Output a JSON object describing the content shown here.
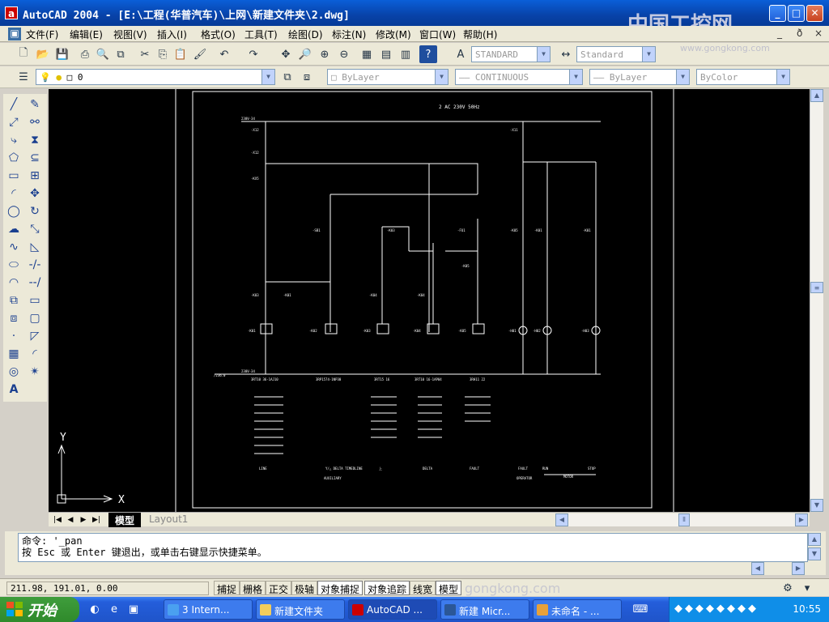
{
  "window": {
    "title": "AutoCAD 2004 - [E:\\工程(华普汽车)\\上网\\新建文件夹\\2.dwg]",
    "app_icon": "a"
  },
  "watermark": {
    "text": "中国工控网",
    "url": "www.gongkong.com",
    "status_url": "gongkong.com"
  },
  "menu": [
    "文件(F)",
    "编辑(E)",
    "视图(V)",
    "插入(I)",
    "格式(O)",
    "工具(T)",
    "绘图(D)",
    "标注(N)",
    "修改(M)",
    "窗口(W)",
    "帮助(H)"
  ],
  "toolbar": {
    "text_style": "STANDARD",
    "dim_style": "Standard",
    "layer": "0",
    "color": "ByLayer",
    "linetype": "CONTINUOUS",
    "lineweight": "ByLayer",
    "plotstyle": "ByColor"
  },
  "drawing": {
    "header": "2 AC 230V 50Hz",
    "bus_top_label": "230V-34",
    "bus_bottom_label": "230V-34",
    "ref_bottom_left": "/236.0",
    "col_labels_top": [
      "-X12",
      "-X12",
      "-X11"
    ],
    "relay_labels": [
      "-KX5",
      "-SB1",
      "-K03",
      "-FU1",
      "-K05",
      "-K01",
      "-K01",
      "-K03",
      "-K01",
      "-K04",
      "-K04",
      "-K05"
    ],
    "coil_labels": [
      "-K01",
      "-K02",
      "-K03",
      "-K04",
      "-K05",
      "-H01",
      "-H02",
      "-H03"
    ],
    "parts": [
      "3RT10 36-1AJ10",
      "3RP1574-1NP30",
      "3RT15 16",
      "3RT10 16-1AP04",
      "3RH11 22"
    ],
    "functions": [
      "LINE",
      "Y/△ DELTA TIMEDLINE",
      "上",
      "DELTA",
      "FAULT",
      "FAULT",
      "RUN",
      "STOP"
    ],
    "footer_left": "AUXILIARY",
    "footer_mid": "OPERATOR",
    "footer_right": "MOTOR"
  },
  "ucs": {
    "x": "X",
    "y": "Y"
  },
  "tabs": [
    "模型",
    "Layout1"
  ],
  "command": {
    "line1": "命令: '_pan",
    "line2": "按 Esc 或 Enter 键退出，或单击右键显示快捷菜单。"
  },
  "status": {
    "coords": "211.98, 191.01, 0.00",
    "toggles": [
      "捕捉",
      "栅格",
      "正交",
      "极轴",
      "对象捕捉",
      "对象追踪",
      "线宽",
      "模型"
    ]
  },
  "taskbar": {
    "start": "开始",
    "tasks": [
      "3 Intern...",
      "新建文件夹",
      "AutoCAD ...",
      "新建 Micr...",
      "未命名 - ..."
    ],
    "clock": "10:55"
  }
}
